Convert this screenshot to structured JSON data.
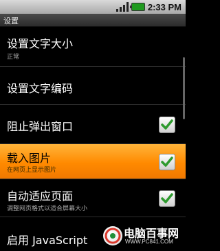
{
  "status_bar": {
    "time": "2:33 PM",
    "icons": [
      "signal-icon",
      "battery-icon"
    ]
  },
  "title_bar": {
    "title": "设置"
  },
  "settings": [
    {
      "title": "设置文字大小",
      "summary": "正常",
      "checkbox": false
    },
    {
      "title": "设置文字编码",
      "summary": "",
      "checkbox": false
    },
    {
      "title": "阻止弹出窗口",
      "summary": "",
      "checkbox": true,
      "checked": true
    },
    {
      "title": "载入图片",
      "summary": "在网页上显示图片",
      "checkbox": true,
      "checked": true,
      "highlighted": true
    },
    {
      "title": "自动适应页面",
      "summary": "调整网页格式以适合屏幕大小",
      "checkbox": true,
      "checked": true
    },
    {
      "title": "启用 JavaScript",
      "summary": "",
      "checkbox": true,
      "checked": true
    }
  ],
  "watermark": {
    "text": "电脑百事网",
    "url": "WWW.PC841.COM"
  },
  "colors": {
    "highlight": "#ff8a00",
    "check": "#2e9a2e",
    "background": "#000000"
  }
}
